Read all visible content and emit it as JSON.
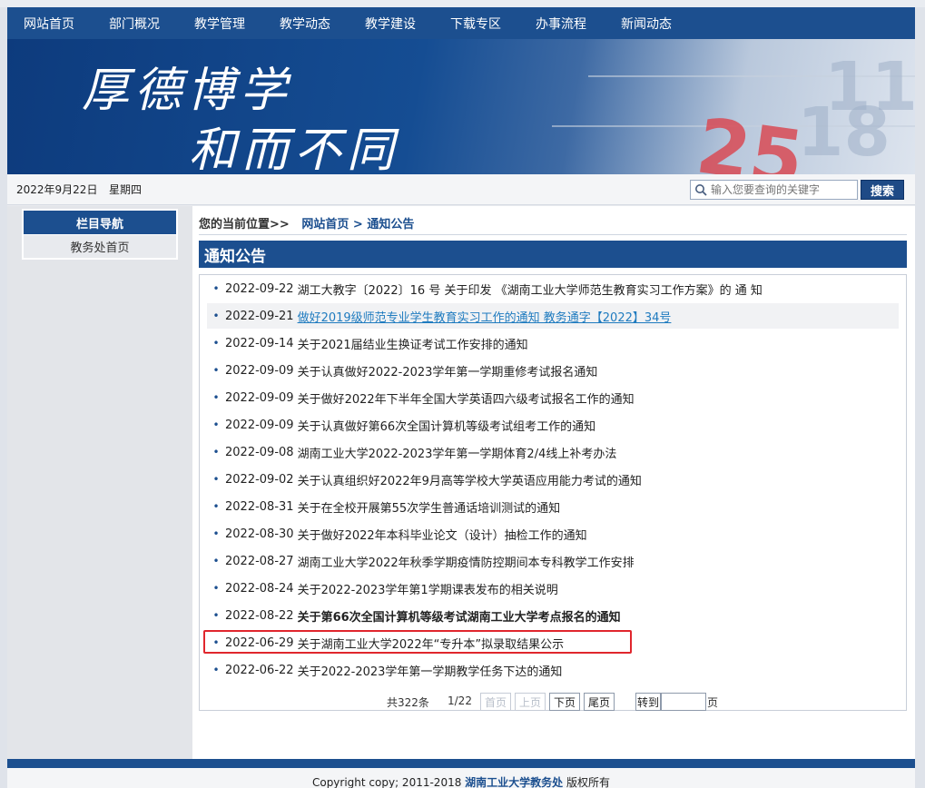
{
  "nav": [
    "网站首页",
    "部门概况",
    "教学管理",
    "教学动态",
    "教学建设",
    "下载专区",
    "办事流程",
    "新闻动态"
  ],
  "banner": {
    "calligraphy_line1": "厚德博学",
    "calligraphy_line2": "和而不同",
    "calendar_numbers": [
      "11",
      "18",
      "25"
    ]
  },
  "infobar": {
    "date": "2022年9月22日",
    "weekday": "星期四",
    "search_placeholder": "输入您要查询的关键字",
    "search_button": "搜索"
  },
  "sidebar": {
    "title": "栏目导航",
    "items": [
      "教务处首页"
    ]
  },
  "breadcrumb": {
    "prefix": "您的当前位置>>",
    "home": "网站首页",
    "sep": ">",
    "current": "通知公告"
  },
  "section_title": "通知公告",
  "notices": [
    {
      "date": "2022-09-22",
      "title": "湖工大教字〔2022〕16 号 关于印发 《湖南工业大学师范生教育实习工作方案》的 通 知"
    },
    {
      "date": "2022-09-21",
      "title": "做好2019级师范专业学生教育实习工作的通知 教务通字【2022】34号"
    },
    {
      "date": "2022-09-14",
      "title": "关于2021届结业生换证考试工作安排的通知"
    },
    {
      "date": "2022-09-09",
      "title": "关于认真做好2022-2023学年第一学期重修考试报名通知"
    },
    {
      "date": "2022-09-09",
      "title": "关于做好2022年下半年全国大学英语四六级考试报名工作的通知"
    },
    {
      "date": "2022-09-09",
      "title": "关于认真做好第66次全国计算机等级考试组考工作的通知"
    },
    {
      "date": "2022-09-08",
      "title": "湖南工业大学2022-2023学年第一学期体育2/4线上补考办法"
    },
    {
      "date": "2022-09-02",
      "title": "关于认真组织好2022年9月高等学校大学英语应用能力考试的通知"
    },
    {
      "date": "2022-08-31",
      "title": "关于在全校开展第55次学生普通话培训测试的通知"
    },
    {
      "date": "2022-08-30",
      "title": "关于做好2022年本科毕业论文（设计）抽检工作的通知"
    },
    {
      "date": "2022-08-27",
      "title": "湖南工业大学2022年秋季学期疫情防控期间本专科教学工作安排"
    },
    {
      "date": "2022-08-24",
      "title": "关于2022-2023学年第1学期课表发布的相关说明"
    },
    {
      "date": "2022-08-22",
      "title": "关于第66次全国计算机等级考试湖南工业大学考点报名的通知"
    },
    {
      "date": "2022-06-29",
      "title": "关于湖南工业大学2022年“专升本”拟录取结果公示"
    },
    {
      "date": "2022-06-22",
      "title": "关于2022-2023学年第一学期教学任务下达的通知"
    }
  ],
  "pager": {
    "total": "共322条",
    "page": "1/22",
    "first": "首页",
    "prev": "上页",
    "next": "下页",
    "last": "尾页",
    "goto": "转到",
    "unit": "页"
  },
  "footer": {
    "prefix": "Copyright copy; 2011-2018",
    "org": "湖南工业大学教务处",
    "suffix": "版权所有"
  },
  "colors": {
    "brand_blue": "#1c4f8f",
    "link_blue": "#1f7bbf",
    "highlight_red": "#e0262d"
  }
}
